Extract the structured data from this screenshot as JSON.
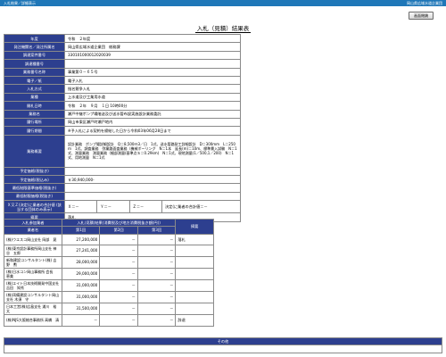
{
  "topbar": {
    "left": "入札結果／詳細表示",
    "right": "岡山県広域水道企業団"
  },
  "buttons": {
    "close": "画面閉鎖"
  },
  "page_title": "入札（見積）結果表",
  "main_rows": [
    {
      "label": "年度",
      "value": "令和　２年度"
    },
    {
      "label": "発注機関名／発注所属名",
      "value": "岡山県広域水道企業団　総務課"
    },
    {
      "label": "調達案件番号",
      "value": "33010100001202003​9"
    },
    {
      "label": "調達種番号",
      "value": ""
    },
    {
      "label": "業務番号名称",
      "value": "事業第０－６５号"
    },
    {
      "label": "電子／紙",
      "value": "電子入札"
    },
    {
      "label": "入札方式",
      "value": "指名競争入札"
    },
    {
      "label": "業種",
      "value": "上水道及び工業用水道"
    },
    {
      "label": "開札日時",
      "value": "令和　２年　９月　１日 10時00分"
    },
    {
      "label": "業務名",
      "value": "瀬戸中継ポンプ場階送及び送水管布設実施設計業務委託"
    },
    {
      "label": "履行場所",
      "value": "岡山市東区瀬戸町瀬戸地内"
    },
    {
      "label": "履行期間",
      "value": "※予入札による契約を締結した日から令和03年06月28日まで"
    },
    {
      "label": "業務概要",
      "value": "設計業務　ポンプ場詳細設計　Q＝8,500ｍ3／日　1式、送水管路耐工詳細設計　D＝300mm　L＝250ｍ　1式、調査業務　弥業路面査業務（機械ボーリング　N＝1本　延長(m)＝10m、標準貫入試験　N＝1式、測量業務　測量業務（細部測量(基準点Ｓ＝0.29km)　N＝1式、現地測量(1／500,1／200)　N＝1式、用地測量　N＝1式",
      "note": true
    },
    {
      "label": "予定価格(税抜き)",
      "value": ""
    },
    {
      "label": "予定価格(税込み)",
      "value": "￥30,940,000-"
    },
    {
      "label": "最低制限基準価格(税抜き)",
      "value": ""
    },
    {
      "label": "最低制限価格(税抜き)",
      "value": ""
    }
  ],
  "xyz_row": {
    "label": "Ｘ又Ｚ(決定)に業者の合計値 (該当する団体のみ表示)",
    "x": "Ｘ＝－",
    "y": "Ｙ＝－",
    "z": "Ｚ＝－",
    "note": "決定(に業者の合計値＝－"
  },
  "result_row": {
    "label": "摘要",
    "value": "落札"
  },
  "bids": {
    "headers": {
      "company": "入札参加業者",
      "results": "入札(見積)結果(消費税及び地方消費税抜き額(円))",
      "remarks": "摘要",
      "name": "業者名",
      "r1": "第1回",
      "r2": "第2回",
      "r3": "第3回"
    },
    "rows": [
      {
        "name": "(株)ウエスコ岡山支社 岡部　晃",
        "r1": "27,200,000",
        "r2": "－",
        "r3": "－",
        "remarks": "落札"
      },
      {
        "name": "(株)東京設計事務所岡山支社 神谷　五郎",
        "r1": "27,241,000",
        "r2": "－",
        "r3": "－",
        "remarks": ""
      },
      {
        "name": "新和建設コンサルタント(株) 吉野　勲",
        "r1": "28,000,000",
        "r2": "－",
        "r3": "－",
        "remarks": ""
      },
      {
        "name": "(株)日水コン岡山事務所 会長　恵美",
        "r1": "29,000,000",
        "r2": "－",
        "r3": "－",
        "remarks": ""
      },
      {
        "name": "(株)エイト日本技術開発中国支社 吉田　知秀",
        "r1": "31,000,000",
        "r2": "－",
        "r3": "－",
        "remarks": ""
      },
      {
        "name": "(株)両備建設コンサルタント岡山支社 木須　守",
        "r1": "31,000,000",
        "r2": "－",
        "r3": "－",
        "remarks": ""
      },
      {
        "name": "日本工営(株)広島支社 浦川　裕太",
        "r1": "31,500,000",
        "r2": "－",
        "r3": "－",
        "remarks": ""
      },
      {
        "name": "(株)NJS大阪総合事務所 高橋　清",
        "r1": "－",
        "r2": "－",
        "r3": "－",
        "remarks": "辞退"
      }
    ]
  },
  "other": {
    "header": "その他",
    "value": ""
  }
}
